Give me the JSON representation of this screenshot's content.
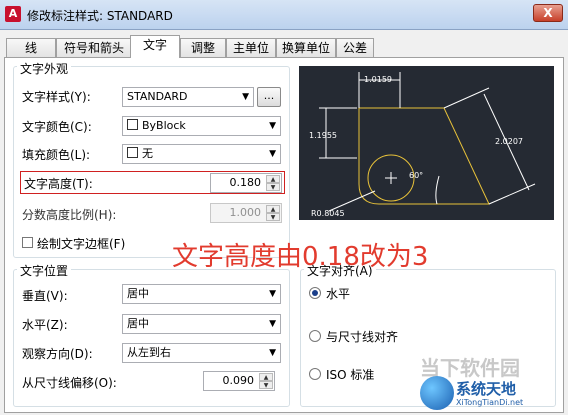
{
  "window": {
    "title": "修改标注样式: STANDARD",
    "close_label": "X",
    "app_icon_label": "A"
  },
  "tabs": [
    "线",
    "符号和箭头",
    "文字",
    "调整",
    "主单位",
    "换算单位",
    "公差"
  ],
  "active_tab": "文字",
  "appearance": {
    "title": "文字外观",
    "style_label": "文字样式(Y):",
    "style_value": "STANDARD",
    "style_button": "...",
    "color_label": "文字颜色(C):",
    "color_value": "ByBlock",
    "fill_label": "填充颜色(L):",
    "fill_value": "无",
    "height_label": "文字高度(T):",
    "height_value": "0.180",
    "fraction_label": "分数高度比例(H):",
    "fraction_value": "1.000",
    "frame_label": "绘制文字边框(F)"
  },
  "placement": {
    "title": "文字位置",
    "vertical_label": "垂直(V):",
    "vertical_value": "居中",
    "horizontal_label": "水平(Z):",
    "horizontal_value": "居中",
    "view_label": "观察方向(D):",
    "view_value": "从左到右",
    "offset_label": "从尺寸线偏移(O):",
    "offset_value": "0.090"
  },
  "alignment": {
    "title": "文字对齐(A)",
    "options": [
      "水平",
      "与尺寸线对齐",
      "ISO 标准"
    ],
    "selected": "水平"
  },
  "preview": {
    "dim_top": "1.0159",
    "dim_left": "1.1955",
    "dim_right": "2.0207",
    "angle": "60°",
    "radius": "R0.8045"
  },
  "annotation": {
    "text": "文字高度由0.18改为3"
  },
  "watermarks": {
    "brand1": "当下软件园",
    "brand2": "系统天地",
    "site": "XiTongTianDi.net"
  },
  "colors": {
    "preview_bg": "#252a33",
    "preview_stroke": "#e8c23a",
    "annotation": "#e23b2e"
  }
}
